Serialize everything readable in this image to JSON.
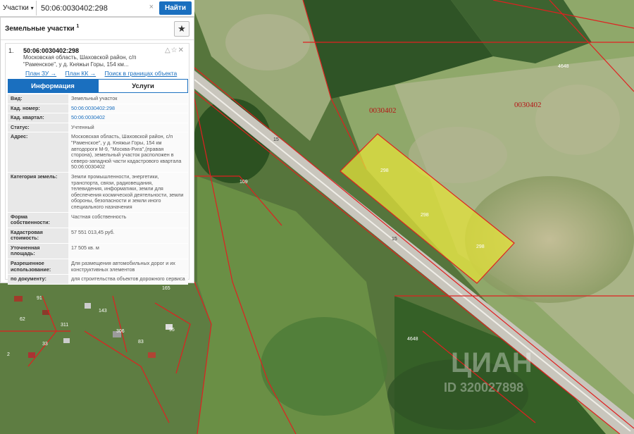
{
  "search": {
    "type_label": "Участки",
    "query": "50:06:0030402:298",
    "button": "Найти"
  },
  "panel": {
    "title": "Земельные участки",
    "title_sup": "1",
    "result": {
      "index": "1.",
      "cadastral_number": "50:06:0030402:298",
      "address_line1": "Московская область, Шаховской район, с/п",
      "address_line2": "\"Раменское\", у д. Княжьи Горы, 154 км..."
    },
    "links": [
      "План ЗУ →",
      "План КК →",
      "Поиск в границах объекта →"
    ],
    "tabs": [
      "Информация",
      "Услуги"
    ],
    "rows": [
      {
        "key": "Вид:",
        "value": "Земельный участок",
        "link": false
      },
      {
        "key": "Кад. номер:",
        "value": "50:06:0030402:298",
        "link": true
      },
      {
        "key": "Кад. квартал:",
        "value": "50:06:0030402",
        "link": true
      },
      {
        "key": "Статус:",
        "value": "Учтенный",
        "link": false
      },
      {
        "key": "Адрес:",
        "value": "Московская область, Шаховской район, с/п \"Раменское\", у д. Княжьи Горы, 154 км автодороги М-9, \"Москва-Рига\",(правая сторона), земельный участок расположен в северо-западной части кадастрового квартала 50:06:0030402",
        "link": false
      },
      {
        "key": "Категория земель:",
        "value": "Земли промышленности, энергетики, транспорта, связи, радиовещания, телевидения, информатики, земли для обеспечения космической деятельности, земли обороны, безопасности и земли иного специального назначения",
        "link": false
      },
      {
        "key": "Форма собственности:",
        "value": "Частная собственность",
        "link": false
      },
      {
        "key": "Кадастровая стоимость:",
        "value": "57 551 013,45 руб.",
        "link": false
      },
      {
        "key": "Уточненная площадь:",
        "value": "17 505 кв. м",
        "link": false
      },
      {
        "key": "Разрешенное использование:",
        "value": "Для размещения автомобильных дорог и их конструктивных элементов",
        "link": false
      },
      {
        "key": "по документу:",
        "value": "для строительства объектов дорожного сервиса",
        "link": false
      }
    ]
  },
  "map": {
    "parcel_label": "298",
    "quarter_label_1": "0030402",
    "quarter_label_2": "0030402",
    "road_label_1": "15",
    "road_label_2": "15",
    "road_label_3": "4648",
    "plot_109": "109",
    "plot_4648_top": "4648",
    "house_labels": [
      "91",
      "165",
      "62",
      "311",
      "306",
      "83",
      "2",
      "143",
      "33",
      "95"
    ],
    "watermark": "ЦИАН",
    "watermark_id": "ID 320027898",
    "colors": {
      "parcel_fill": "#e3e23a",
      "boundary": "#e02020",
      "accent": "#1a6fbf"
    }
  }
}
